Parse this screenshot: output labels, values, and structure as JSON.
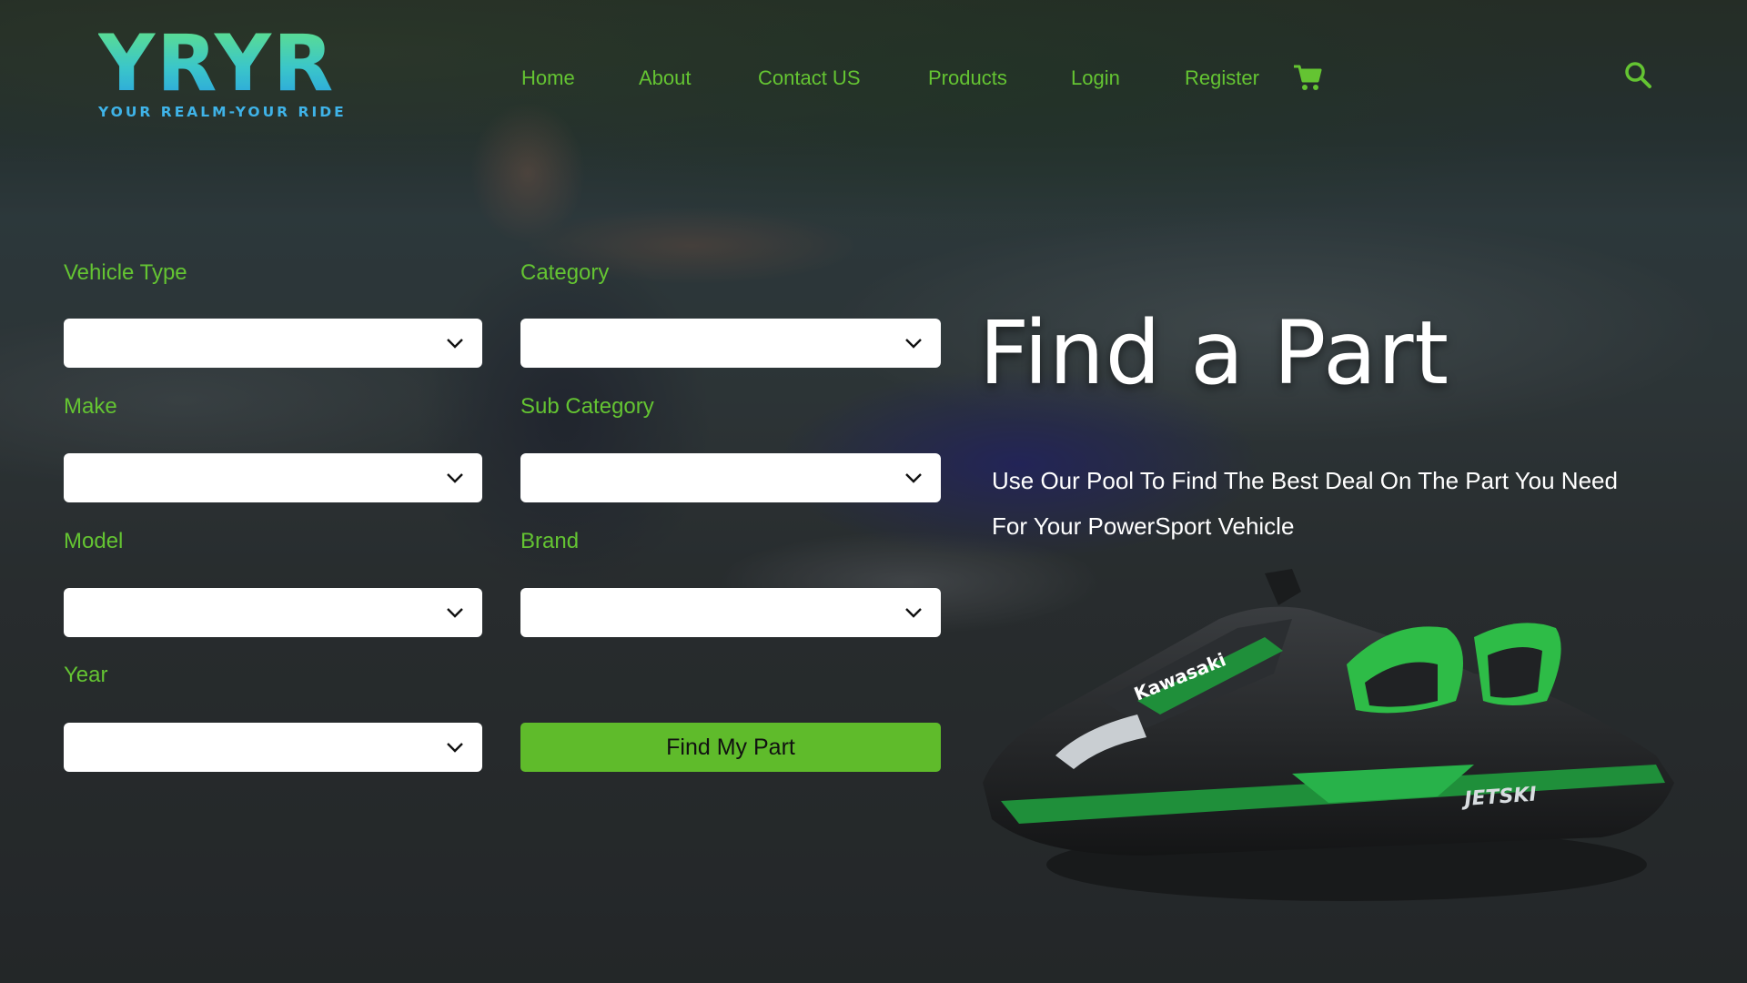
{
  "brand": {
    "logo_text": "YRYR",
    "tagline": "YOUR REALM-YOUR RIDE"
  },
  "nav": {
    "items": [
      {
        "label": "Home"
      },
      {
        "label": "About"
      },
      {
        "label": "Contact US"
      },
      {
        "label": "Products"
      },
      {
        "label": "Login"
      },
      {
        "label": "Register"
      }
    ],
    "cart_icon": "cart-icon",
    "search_icon": "search-icon"
  },
  "form": {
    "vehicle_type": {
      "label": "Vehicle Type",
      "value": ""
    },
    "category": {
      "label": "Category",
      "value": ""
    },
    "make": {
      "label": "Make",
      "value": ""
    },
    "sub_category": {
      "label": "Sub Category",
      "value": ""
    },
    "model": {
      "label": "Model",
      "value": ""
    },
    "brand": {
      "label": "Brand",
      "value": ""
    },
    "year": {
      "label": "Year",
      "value": ""
    },
    "submit_label": "Find My Part"
  },
  "hero": {
    "title": "Find a Part",
    "subtitle_line1": "Use Our Pool To Find The Best Deal On The Part You Need",
    "subtitle_line2": "For Your PowerSport Vehicle"
  },
  "jetski_decal": {
    "brand": "Kawasaki",
    "model": "JETSKI"
  },
  "colors": {
    "accent_green": "#64c432",
    "button_green": "#5fbb2b",
    "logo_gradient_top": "#5fe08a",
    "logo_gradient_bottom": "#2aa3e0"
  }
}
